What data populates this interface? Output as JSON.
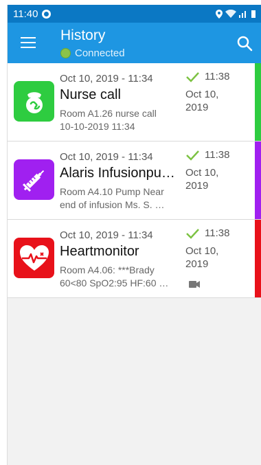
{
  "status_bar": {
    "time": "11:40"
  },
  "header": {
    "title": "History",
    "connection": "Connected"
  },
  "colors": {
    "statusbar": "#0b78c4",
    "appbar": "#1e96e2",
    "connected": "#8bc34a",
    "check": "#7cc242"
  },
  "items": [
    {
      "time": "Oct 10, 2019 - 11:34",
      "name": "Nurse call",
      "desc1": "Room A1.26 nurse call",
      "desc2": "10-10-2019 11:34",
      "ack_time": "11:38",
      "ack_date1": "Oct 10,",
      "ack_date2": "2019",
      "icon": "nurse-call-icon",
      "color": "#2ecc40"
    },
    {
      "time": "Oct 10, 2019 - 11:34",
      "name": "Alaris Infusionpu…",
      "desc1": "Room A4.10 Pump Near",
      "desc2": "end of infusion Ms. S. …",
      "ack_time": "11:38",
      "ack_date1": "Oct 10,",
      "ack_date2": "2019",
      "icon": "syringe-icon",
      "color": "#a020f0"
    },
    {
      "time": "Oct 10, 2019 - 11:34",
      "name": "Heartmonitor",
      "desc1": "Room A4.06: ***Brady",
      "desc2": "60<80 SpO2:95 HF:60 …",
      "ack_time": "11:38",
      "ack_date1": "Oct 10,",
      "ack_date2": "2019",
      "icon": "heart-monitor-icon",
      "color": "#e8111a"
    }
  ]
}
